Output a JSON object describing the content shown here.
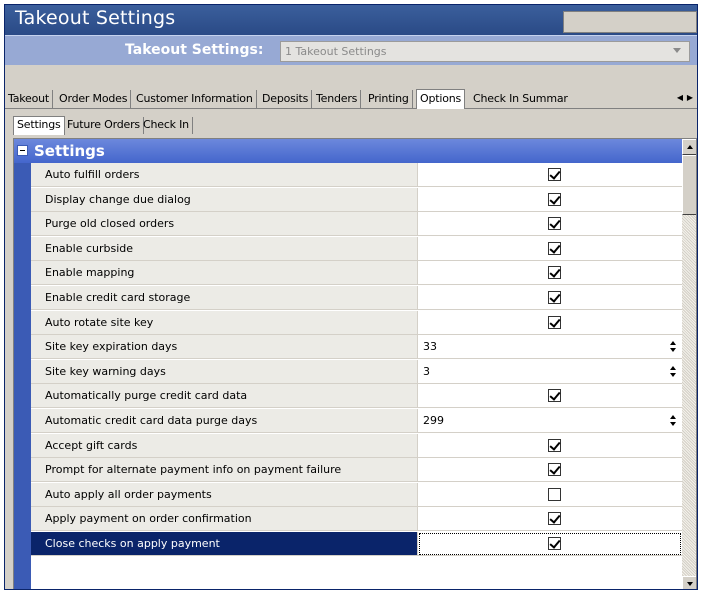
{
  "window": {
    "title": "Takeout Settings"
  },
  "selector": {
    "label": "Takeout Settings:",
    "value": "1 Takeout Settings"
  },
  "tabs": [
    {
      "label": "Takeout",
      "active": false
    },
    {
      "label": "Order Modes",
      "active": false
    },
    {
      "label": "Customer Information",
      "active": false
    },
    {
      "label": "Deposits",
      "active": false
    },
    {
      "label": "Tenders",
      "active": false
    },
    {
      "label": "Printing",
      "active": false
    },
    {
      "label": "Options",
      "active": true
    },
    {
      "label": "Check In Summar",
      "active": false
    }
  ],
  "subtabs": [
    {
      "label": "Settings",
      "active": true
    },
    {
      "label": "Future Orders",
      "active": false
    },
    {
      "label": "Check In",
      "active": false
    }
  ],
  "group": {
    "label": "Settings"
  },
  "rows": [
    {
      "name": "Auto fulfill orders",
      "type": "checkbox",
      "checked": true
    },
    {
      "name": "Display change due dialog",
      "type": "checkbox",
      "checked": true
    },
    {
      "name": "Purge old closed orders",
      "type": "checkbox",
      "checked": true
    },
    {
      "name": "Enable curbside",
      "type": "checkbox",
      "checked": true
    },
    {
      "name": "Enable mapping",
      "type": "checkbox",
      "checked": true
    },
    {
      "name": "Enable credit card storage",
      "type": "checkbox",
      "checked": true
    },
    {
      "name": "Auto rotate site key",
      "type": "checkbox",
      "checked": true
    },
    {
      "name": "Site key expiration days",
      "type": "number",
      "value": "33"
    },
    {
      "name": "Site key warning days",
      "type": "number",
      "value": "3"
    },
    {
      "name": "Automatically purge credit card data",
      "type": "checkbox",
      "checked": true
    },
    {
      "name": "Automatic credit card data purge days",
      "type": "number",
      "value": "299"
    },
    {
      "name": "Accept gift cards",
      "type": "checkbox",
      "checked": true
    },
    {
      "name": "Prompt for alternate payment info on payment failure",
      "type": "checkbox",
      "checked": true
    },
    {
      "name": "Auto apply all order payments",
      "type": "checkbox",
      "checked": false
    },
    {
      "name": "Apply payment on order confirmation",
      "type": "checkbox",
      "checked": true
    },
    {
      "name": "Close checks on apply payment",
      "type": "checkbox",
      "checked": true,
      "selected": true
    }
  ]
}
